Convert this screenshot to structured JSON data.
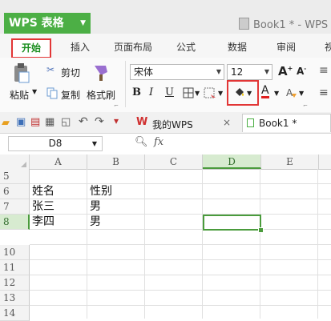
{
  "app": {
    "name": "WPS 表格",
    "doc_title": "Book1 * - WPS 表"
  },
  "tabs": [
    "开始",
    "插入",
    "页面布局",
    "公式",
    "数据",
    "审阅",
    "视"
  ],
  "ribbon": {
    "paste": "粘贴",
    "cut": "剪切",
    "copy": "复制",
    "format_painter": "格式刷",
    "font_name": "宋体",
    "font_size": "12",
    "bold": "B",
    "italic": "I",
    "underline": "U",
    "font_color_glyph": "A"
  },
  "quickbar": {
    "mywps": "我的WPS",
    "doc_tab": "Book1 *"
  },
  "formula_bar": {
    "name_box": "D8",
    "fx": "fx"
  },
  "columns": [
    "A",
    "B",
    "C",
    "D",
    "E"
  ],
  "rows": [
    "5",
    "6",
    "7",
    "8",
    "10",
    "11",
    "12",
    "13",
    "14"
  ],
  "cells": {
    "A6": "姓名",
    "B6": "性别",
    "A7": "张三",
    "B7": "男",
    "A8": "李四",
    "B8": "男"
  },
  "colors": {
    "accent": "#4caf45",
    "highlight": "#e23636",
    "selection": "#4a9b3c"
  }
}
